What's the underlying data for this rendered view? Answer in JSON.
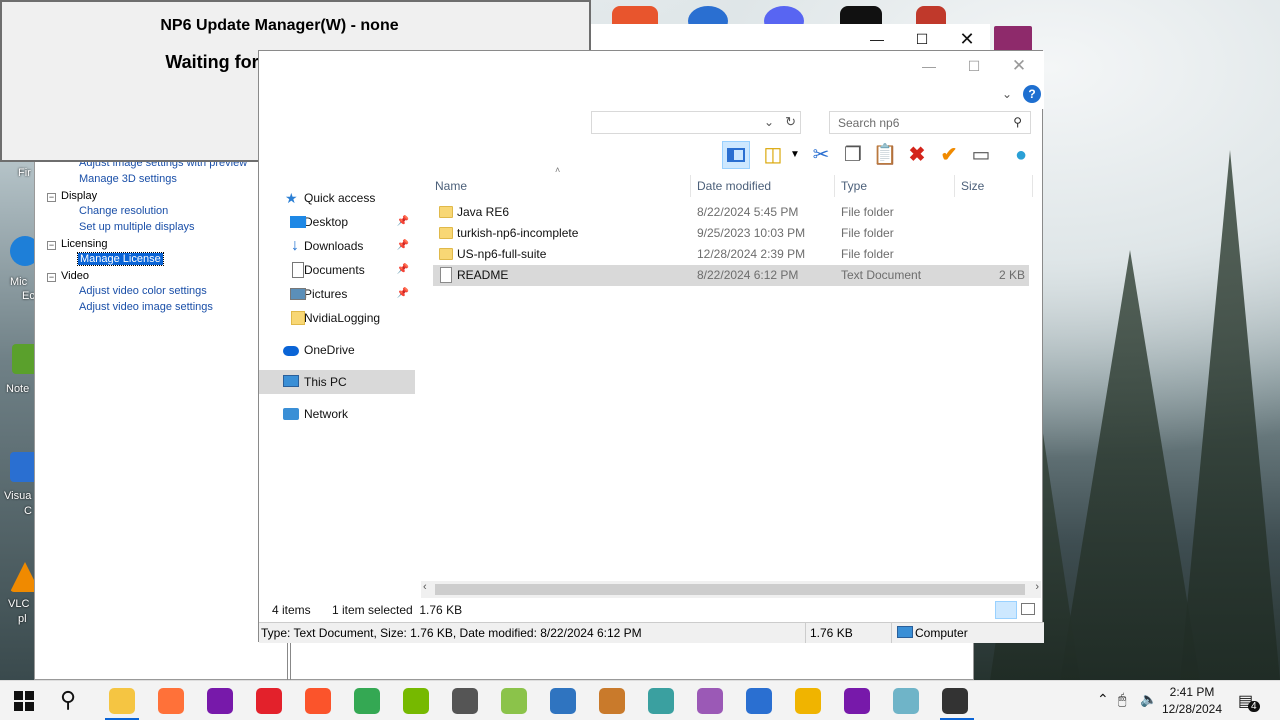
{
  "update_dialog": {
    "title": "NP6 Update Manager(W) - none",
    "status": "Waiting for Update Service"
  },
  "nvidia_panel": {
    "tree": [
      {
        "type": "link",
        "label": "Adjust image settings with preview"
      },
      {
        "type": "link",
        "label": "Manage 3D settings"
      },
      {
        "type": "group",
        "label": "Display"
      },
      {
        "type": "link",
        "label": "Change resolution"
      },
      {
        "type": "link",
        "label": "Set up multiple displays"
      },
      {
        "type": "group",
        "label": "Licensing"
      },
      {
        "type": "link",
        "label": "Manage License",
        "selected": true
      },
      {
        "type": "group",
        "label": "Video"
      },
      {
        "type": "link",
        "label": "Adjust video color settings"
      },
      {
        "type": "link",
        "label": "Adjust video image settings"
      }
    ]
  },
  "explorer": {
    "search_placeholder": "Search np6",
    "nav": [
      {
        "label": "Quick access",
        "icon": "star-icon",
        "color": "#2b7fd4"
      },
      {
        "label": "Desktop",
        "icon": "desktop-icon",
        "pinned": true,
        "color": "#1e88e5"
      },
      {
        "label": "Downloads",
        "icon": "download-icon",
        "pinned": true,
        "color": "#1e6fd0"
      },
      {
        "label": "Documents",
        "icon": "documents-icon",
        "pinned": true,
        "color": "#8a8a8a"
      },
      {
        "label": "Pictures",
        "icon": "pictures-icon",
        "pinned": true,
        "color": "#5b8fb9"
      },
      {
        "label": "NvidiaLogging",
        "icon": "folder-icon",
        "color": "#f8d775"
      },
      {
        "label": "OneDrive",
        "icon": "cloud-icon",
        "color": "#0a64d6"
      },
      {
        "label": "This PC",
        "icon": "computer-icon",
        "selected": true,
        "color": "#3a8fd6"
      },
      {
        "label": "Network",
        "icon": "network-icon",
        "color": "#3a8fd6"
      }
    ],
    "columns": {
      "name": "Name",
      "date": "Date modified",
      "type": "Type",
      "size": "Size"
    },
    "files": [
      {
        "name": "Java RE6",
        "date": "8/22/2024 5:45 PM",
        "type": "File folder",
        "size": "",
        "kind": "folder"
      },
      {
        "name": "turkish-np6-incomplete",
        "date": "9/25/2023 10:03 PM",
        "type": "File folder",
        "size": "",
        "kind": "folder"
      },
      {
        "name": "US-np6-full-suite",
        "date": "12/28/2024 2:39 PM",
        "type": "File folder",
        "size": "",
        "kind": "folder"
      },
      {
        "name": "README",
        "date": "8/22/2024 6:12 PM",
        "type": "Text Document",
        "size": "2 KB",
        "kind": "document",
        "selected": true
      }
    ],
    "status": {
      "items": "4 items",
      "selection": "1 item selected  1.76 KB"
    },
    "info_bar": {
      "details": "Type: Text Document, Size: 1.76 KB, Date modified: 8/22/2024 6:12 PM",
      "size": "1.76 KB",
      "location": "Computer"
    }
  },
  "desktop_labels": [
    "Fir",
    "Mic",
    "Ec",
    "Note",
    "Visua",
    "C",
    "VLC",
    "pl"
  ],
  "taskbar": {
    "clock_time": "2:41 PM",
    "clock_date": "12/28/2024",
    "notification_count": "4",
    "apps": [
      {
        "name": "file-explorer-icon",
        "color": "#f5c542"
      },
      {
        "name": "firefox-icon",
        "color": "#ff7139"
      },
      {
        "name": "onenote-icon",
        "color": "#7719aa"
      },
      {
        "name": "opera-icon",
        "color": "#e3212b"
      },
      {
        "name": "brave-icon",
        "color": "#fb542b"
      },
      {
        "name": "chrome-icon",
        "color": "#34a853"
      },
      {
        "name": "nvidia-icon",
        "color": "#76b900"
      },
      {
        "name": "calendar-app-icon",
        "color": "#555555"
      },
      {
        "name": "green-app-icon",
        "color": "#8bc34a"
      },
      {
        "name": "r-app-icon",
        "color": "#2f74c0"
      },
      {
        "name": "bug-app-icon",
        "color": "#c97a2b"
      },
      {
        "name": "network-app-icon",
        "color": "#3aa0a0"
      },
      {
        "name": "purple-app-icon",
        "color": "#9b59b6"
      },
      {
        "name": "blue-app-icon",
        "color": "#2a6fd1"
      },
      {
        "name": "circle-app-icon",
        "color": "#f0b400"
      },
      {
        "name": "onenote-2-icon",
        "color": "#7719aa"
      },
      {
        "name": "tile-app-icon",
        "color": "#6fb4c8"
      },
      {
        "name": "dark-app-icon",
        "color": "#333333"
      }
    ]
  }
}
